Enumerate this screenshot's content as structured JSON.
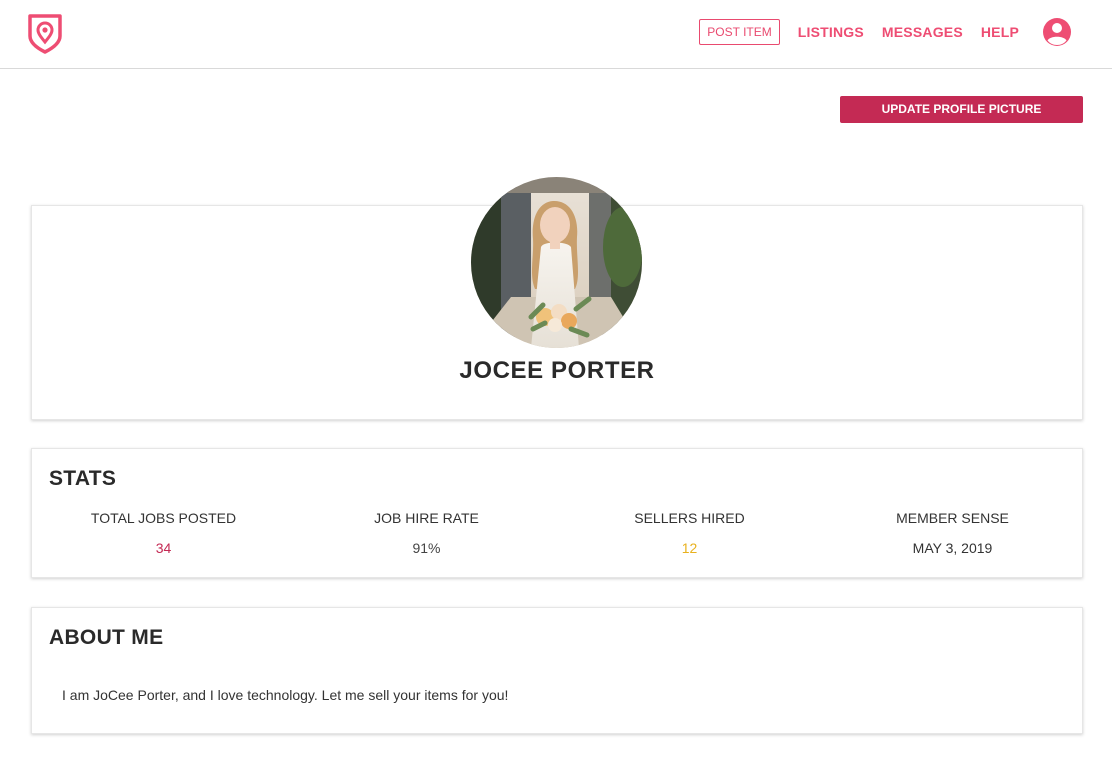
{
  "header": {
    "logo": "location-pin-logo",
    "post_item_label": "POST ITEM",
    "nav": [
      "LISTINGS",
      "MESSAGES",
      "HELP"
    ],
    "account_icon": "user-circle-icon",
    "accent_color": "#ee4d73"
  },
  "profile": {
    "update_picture_label": "UPDATE PROFILE PICTURE",
    "name": "JOCEE PORTER",
    "photo": "profile-photo"
  },
  "stats": {
    "title": "STATS",
    "items": [
      {
        "label": "TOTAL JOBS POSTED",
        "value": "34",
        "color": "#c42a54"
      },
      {
        "label": "JOB HIRE RATE",
        "value": "91%",
        "color": "#444444"
      },
      {
        "label": "SELLERS HIRED",
        "value": "12",
        "color": "#e8b11e"
      },
      {
        "label": "MEMBER SENSE",
        "value": "MAY 3, 2019",
        "color": "#333333"
      }
    ]
  },
  "about": {
    "title": "ABOUT ME",
    "text": "I am JoCee Porter, and I love technology. Let me sell your items for you!"
  }
}
